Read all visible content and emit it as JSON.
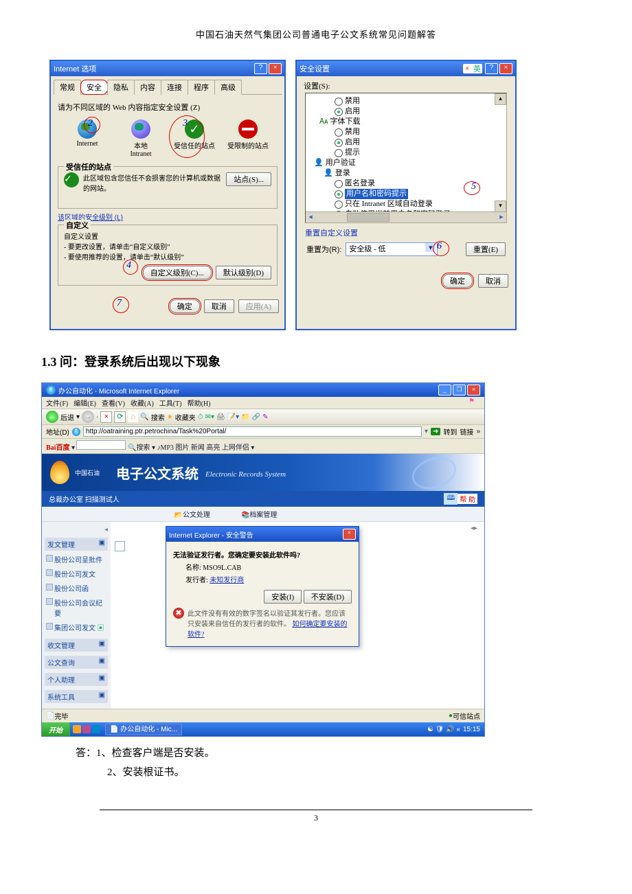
{
  "doc": {
    "header": "中国石油天然气集团公司普通电子公文系统常见问题解答",
    "page_number": "3",
    "q13_title": "1.3 问：登录系统后出现以下现象",
    "answer1": "答：1、检查客户端是否安装。",
    "answer2": "2、安装根证书。"
  },
  "inet": {
    "title": "Internet 选项",
    "tabs": [
      "常规",
      "安全",
      "隐私",
      "内容",
      "连接",
      "程序",
      "高级"
    ],
    "zones_label": "请为不同区域的 Web 内容指定安全设置 (Z)",
    "zone_internet": "Internet",
    "zone_intranet": "本地\nIntranet",
    "zone_trusted": "受信任的站点",
    "zone_restricted": "受限制的站点",
    "trusted_box_title": "受信任的站点",
    "trusted_box_desc": "此区域包含您信任不会损害您的计算机或数据的网站。",
    "sites_btn": "站点(S)...",
    "zone_level_link": "该区域的安全级别 (L)",
    "custom_title": "自定义",
    "custom_l1": "自定义设置",
    "custom_l2": "- 要更改设置，请单击“自定义级别”",
    "custom_l3": "- 要使用推荐的设置，请单击“默认级别”",
    "btn_custom": "自定义级别(C)...",
    "btn_default": "默认级别(D)",
    "btn_ok": "确定",
    "btn_cancel": "取消",
    "btn_apply": "应用(A)",
    "marks": {
      "n2": "2",
      "n3": "3",
      "n4": "4",
      "n7": "7"
    }
  },
  "sec": {
    "title": "安全设置",
    "settings_label": "设置(S):",
    "opt_disable": "禁用",
    "opt_enable": "启用",
    "grp_font": "字体下载",
    "opt_prompt": "提示",
    "grp_userauth": "用户验证",
    "grp_login": "登录",
    "opt_anon": "匿名登录",
    "opt_userpass": "用户名和密码提示",
    "opt_intranet_auto": "只在 Intranet 区域自动登录",
    "opt_current_auto": "自动使用当前用户名和密码登录",
    "reset_title": "重置自定义设置",
    "reset_to": "重置为(R):",
    "reset_value": "安全级 - 低",
    "btn_reset": "重置(E)",
    "btn_ok": "确定",
    "btn_cancel": "取消",
    "marks": {
      "n5": "5",
      "n6": "6"
    }
  },
  "ie": {
    "title": "办公自动化 - Microsoft Internet Explorer",
    "menu": [
      "文件(F)",
      "编辑(E)",
      "查看(V)",
      "收藏(A)",
      "工具(T)",
      "帮助(H)"
    ],
    "back": "后退",
    "search": "搜索",
    "fav": "收藏夹",
    "addr_label": "地址(D)",
    "url": "http://oatraining.ptr.petrochina/Task%20Portal/",
    "go": "转到",
    "links": "链接",
    "bar2_brand": "Bai",
    "bar2_brand2": "百度",
    "bar2_search": "搜索",
    "bar2_items": "MP3  图片  新闻   高亮   上网伴侣 ▾",
    "portal_cn": "电子公文系统",
    "portal_en": "Electronic Records System",
    "portal_logo_text": "中国石油",
    "sub_left": "总裁办公室  扫描测试人",
    "sub_doc": "公文处理",
    "sub_arch": "档案管理",
    "sub_help": "帮 助",
    "side_send_hdr": "发文管理",
    "side_items_send": [
      "股份公司呈批件",
      "股份公司发文",
      "股份公司函",
      "股份公司会议纪要",
      "集团公司发文"
    ],
    "side_other": [
      "收文管理",
      "公文查询",
      "个人助理",
      "系统工具"
    ],
    "warn_title": "Internet Explorer - 安全警告",
    "warn_q": "无法验证发行者。您确定要安装此软件吗?",
    "warn_name_l": "名称:",
    "warn_name_v": "MSO9L.CAB",
    "warn_pub_l": "发行者:",
    "warn_pub_v": "未知发行商",
    "warn_install": "安装(I)",
    "warn_no": "不安装(D)",
    "warn_note": "此文件没有有效的数字签名以验证其发行者。您应该只安装来自信任的发行者的软件。",
    "warn_note_link": "如何确定要安装的软件?",
    "status_done": "完毕",
    "status_trusted": "可信站点",
    "start": "开始",
    "task1": "办公自动化 - Mic...",
    "clock": "15:15"
  }
}
